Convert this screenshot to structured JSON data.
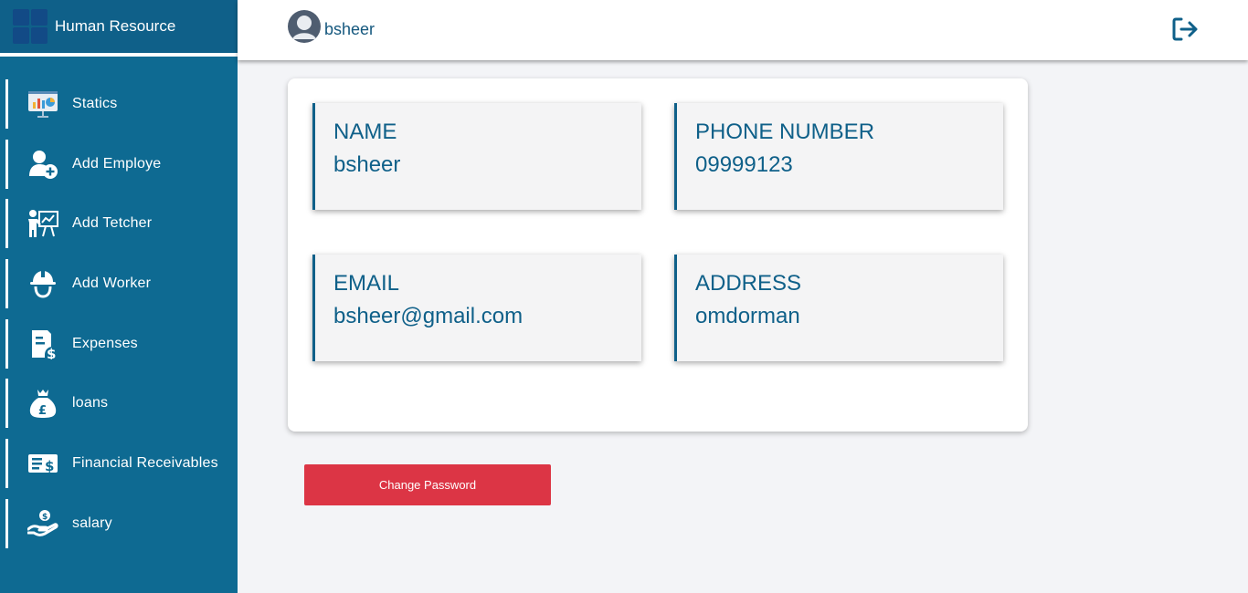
{
  "app": {
    "title": "Human Resource"
  },
  "header": {
    "username": "bsheer"
  },
  "sidebar": {
    "items": [
      {
        "label": "Statics",
        "icon": "presentation-chart-icon"
      },
      {
        "label": "Add Employe",
        "icon": "add-user-icon"
      },
      {
        "label": "Add Tetcher",
        "icon": "teacher-board-icon"
      },
      {
        "label": "Add Worker",
        "icon": "worker-helmet-icon"
      },
      {
        "label": "Expenses",
        "icon": "invoice-dollar-icon"
      },
      {
        "label": "loans",
        "icon": "money-bag-icon"
      },
      {
        "label": "Financial Receivables",
        "icon": "dollar-cheque-icon"
      },
      {
        "label": "salary",
        "icon": "hand-coin-icon"
      }
    ]
  },
  "profile": {
    "name_label": "NAME",
    "name_value": "bsheer",
    "phone_label": "PHONE NUMBER",
    "phone_value": "09999123",
    "email_label": "EMAIL",
    "email_value": "bsheer@gmail.com",
    "address_label": "ADDRESS",
    "address_value": "omdorman"
  },
  "actions": {
    "change_password": "Change Password"
  },
  "colors": {
    "sidebar": "#0e6a92",
    "accent": "#0f6089",
    "danger": "#dc3545",
    "background": "#f3f4f7"
  }
}
